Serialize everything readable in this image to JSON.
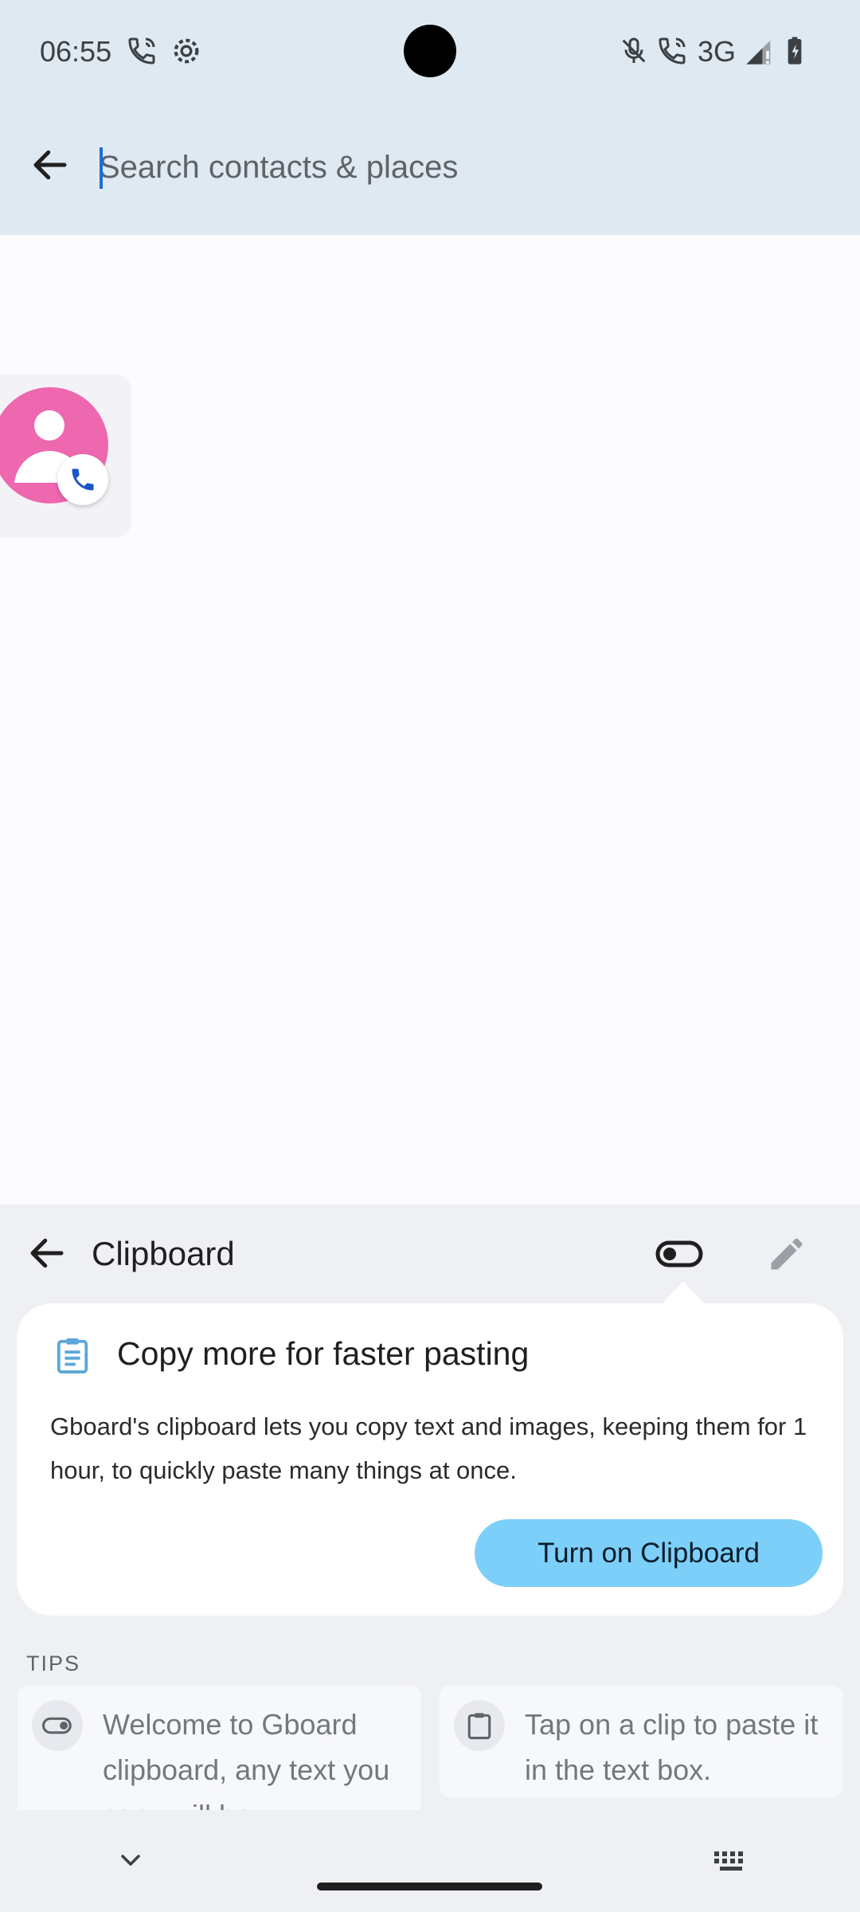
{
  "status_bar": {
    "time": "06:55",
    "network": "3G",
    "left_icons": [
      "wifi-calling-icon",
      "settings-gear-icon"
    ],
    "right_icons": [
      "mute-icon",
      "wifi-calling-icon",
      "signal-icon",
      "battery-charging-icon"
    ]
  },
  "search": {
    "placeholder": "Search contacts & places",
    "value": ""
  },
  "clipboard": {
    "title": "Clipboard",
    "promo": {
      "title": "Copy more for faster pasting",
      "body": "Gboard's clipboard lets you copy text and images, keeping them for 1 hour, to quickly paste many things at once.",
      "button_label": "Turn on Clipboard"
    },
    "tips_label": "TIPS",
    "tips": [
      {
        "icon": "toggle-icon",
        "text": "Welcome to Gboard clipboard, any text you copy will be"
      },
      {
        "icon": "clipboard-icon",
        "text": "Tap on a clip to paste it in the text box."
      }
    ]
  },
  "colors": {
    "header_bg": "#dfe9f1",
    "avatar": "#ee68b0",
    "accent_button": "#7ccff8",
    "caret": "#1c6fd0"
  }
}
